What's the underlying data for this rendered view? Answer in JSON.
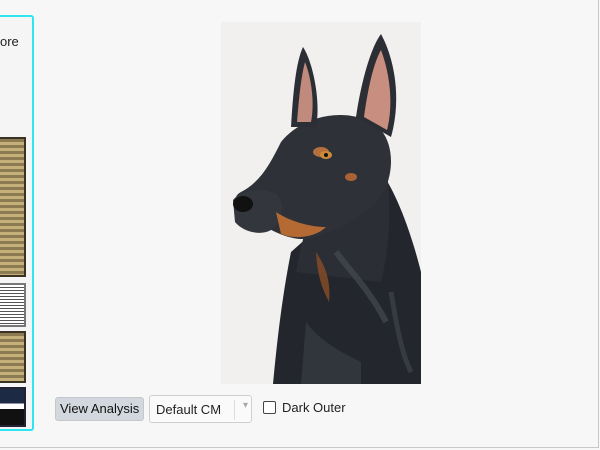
{
  "left_panel": {
    "label_fragment": "ore"
  },
  "image": {
    "subject": "doberman-portrait",
    "background_color": "#f2f0ee"
  },
  "controls": {
    "view_analysis_label": "View Analysis",
    "colormap_selected": "Default CM",
    "dark_outer_label": "Dark Outer",
    "dark_outer_checked": false
  },
  "colors": {
    "highlight_outline": "#2ee6f0",
    "button_bg": "#d3d8de"
  }
}
